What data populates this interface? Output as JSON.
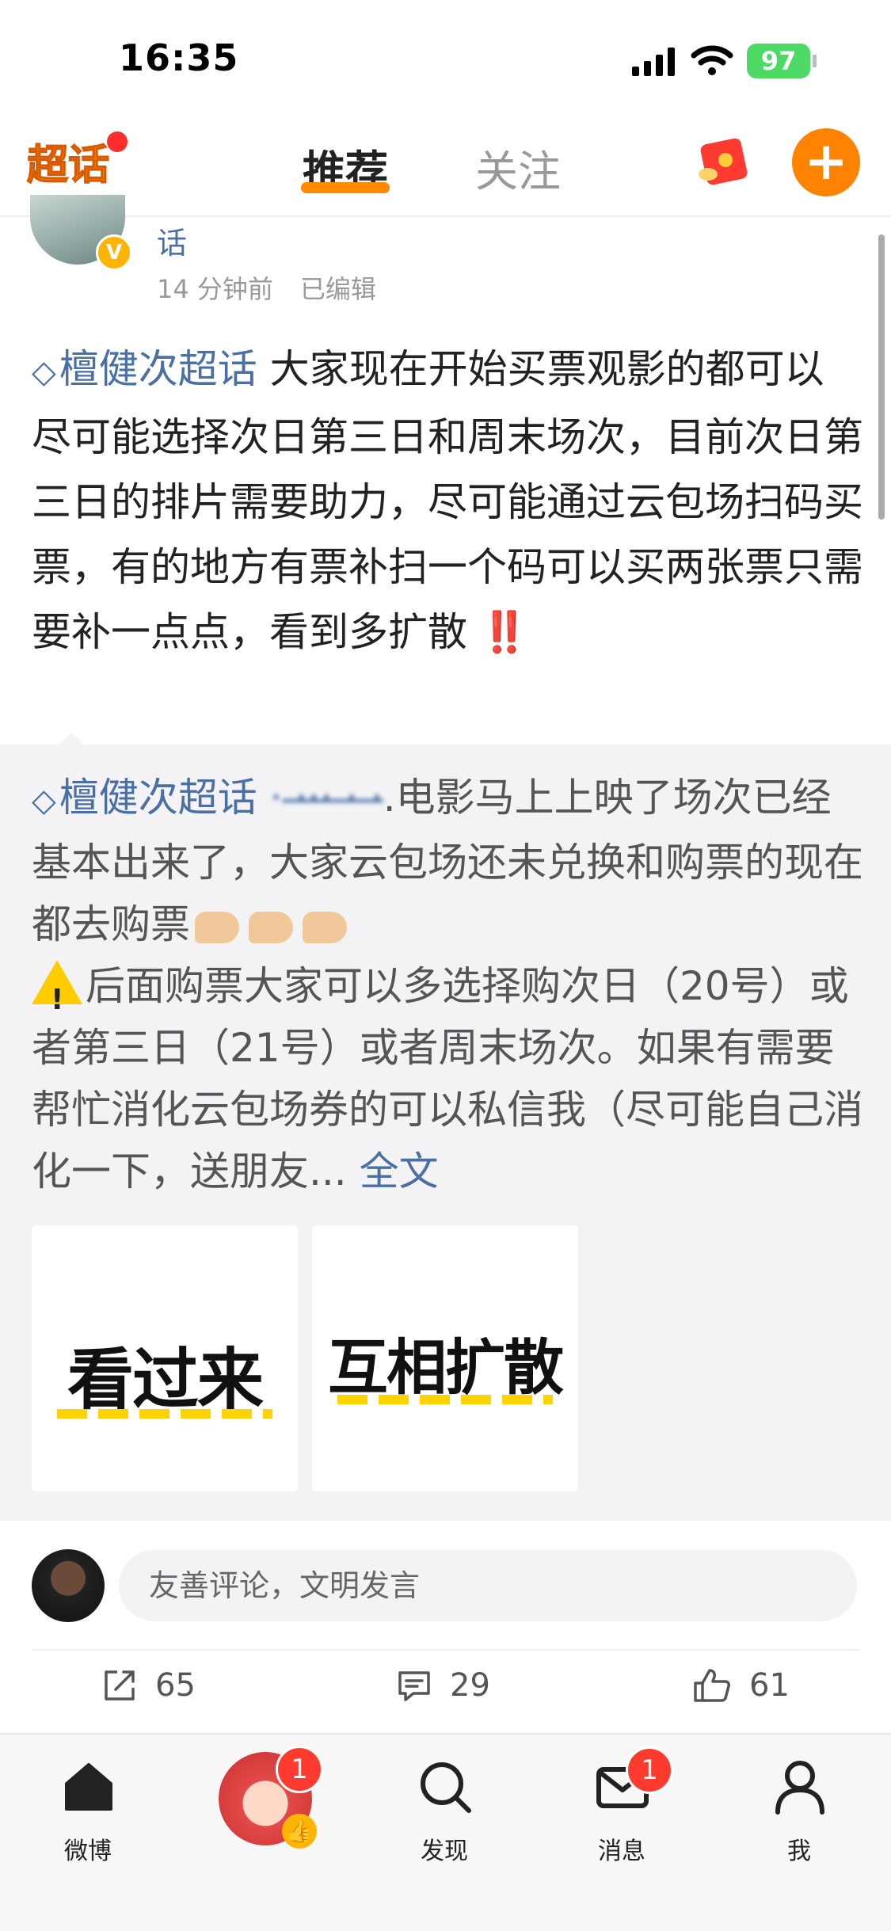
{
  "status_bar": {
    "time": "16:35",
    "battery": "97"
  },
  "header": {
    "logo_text": "超话",
    "tabs": [
      {
        "label": "推荐",
        "active": true
      },
      {
        "label": "关注",
        "active": false
      }
    ],
    "add_label": "+"
  },
  "post": {
    "author_name_tail": "话",
    "verified_mark": "V",
    "time": "14 分钟前",
    "edited": "已编辑",
    "topic": "檀健次超话",
    "text": " 大家现在开始买票观影的都可以尽可能选择次日第三日和周末场次，目前次日第三日的排片需要助力，尽可能通过云包场扫码买票，有的地方有票补扫一个码可以买两张票只需要补一点点，看到多扩散",
    "emphasis": "‼️"
  },
  "repost": {
    "topic": "檀健次超话",
    "blurred_text": "· ·̶̶̶̶·̶̶·̶ ·̶̶̶̶ ·̶̶",
    "text_1": ".电影马上上映了场次已经基本出来了，大家云包场还未兑换和购票的现在都去购票",
    "warn_mark": "!",
    "text_2": "后面购票大家可以多选择购次日（20号）或者第三日（21号）或者周末场次。如果有需要帮忙消化云包场券的可以私信我（尽可能自己消化一下，送朋友...",
    "full_text_link": "全文",
    "images": [
      {
        "text": "看过来"
      },
      {
        "text": "互相扩散"
      }
    ]
  },
  "comment_bar": {
    "placeholder": "友善评论，文明发言"
  },
  "actions": {
    "repost": "65",
    "comment": "29",
    "like": "61"
  },
  "bottom_nav": {
    "home": "微博",
    "discover": "发现",
    "messages": "消息",
    "me": "我",
    "center_badge": "1",
    "messages_badge": "1"
  },
  "colors": {
    "accent": "#ff8200",
    "link": "#4a6fa5",
    "badge": "#ff3b30"
  }
}
